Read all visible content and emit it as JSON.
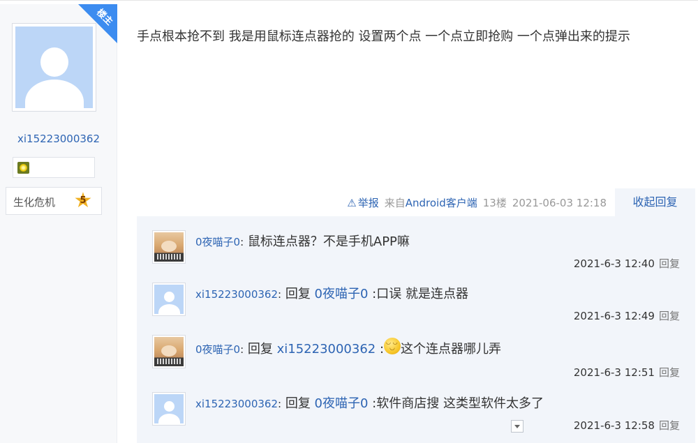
{
  "author": {
    "badge": "楼主",
    "name": "xi15223000362",
    "rank_name": "生化危机",
    "rank_level": "5"
  },
  "post": {
    "content": "手点根本抢不到 我是用鼠标连点器抢的 设置两个点 一个点立即抢购 一个点弹出来的提示"
  },
  "meta": {
    "report_icon": "⚠",
    "report": "举报",
    "from_prefix": "来自",
    "from_client": "Android客户端",
    "floor": "13楼",
    "time": "2021-06-03 12:18",
    "collapse": "收起回复"
  },
  "replies": [
    {
      "user": "0夜喵子0",
      "colon": ":",
      "reply_prefix": "",
      "target": "",
      "text": " 鼠标连点器？不是手机APP嘛",
      "time": "2021-6-3 12:40",
      "reply_link": "回复",
      "avatar": "cat-avatar"
    },
    {
      "user": "xi15223000362",
      "colon": ":",
      "reply_prefix": " 回复 ",
      "target": "0夜喵子0",
      "text": " :口误 就是连点器",
      "time": "2021-6-3 12:49",
      "reply_link": "回复",
      "avatar": "default-avatar"
    },
    {
      "user": "0夜喵子0",
      "colon": ":",
      "reply_prefix": " 回复 ",
      "target": "xi15223000362",
      "text": "这个连点器哪儿弄",
      "time": "2021-6-3 12:51",
      "reply_link": "回复",
      "avatar": "cat-avatar"
    },
    {
      "user": "xi15223000362",
      "colon": ":",
      "reply_prefix": " 回复 ",
      "target": "0夜喵子0",
      "text": " :软件商店搜 这类型软件太多了",
      "time": "2021-6-3 12:58",
      "reply_link": "回复",
      "avatar": "default-avatar"
    }
  ],
  "reply3_sep": " :",
  "colors": {
    "link": "#2d64b3",
    "panel": "#f2f5fa",
    "badge": "#3c8cf0"
  }
}
